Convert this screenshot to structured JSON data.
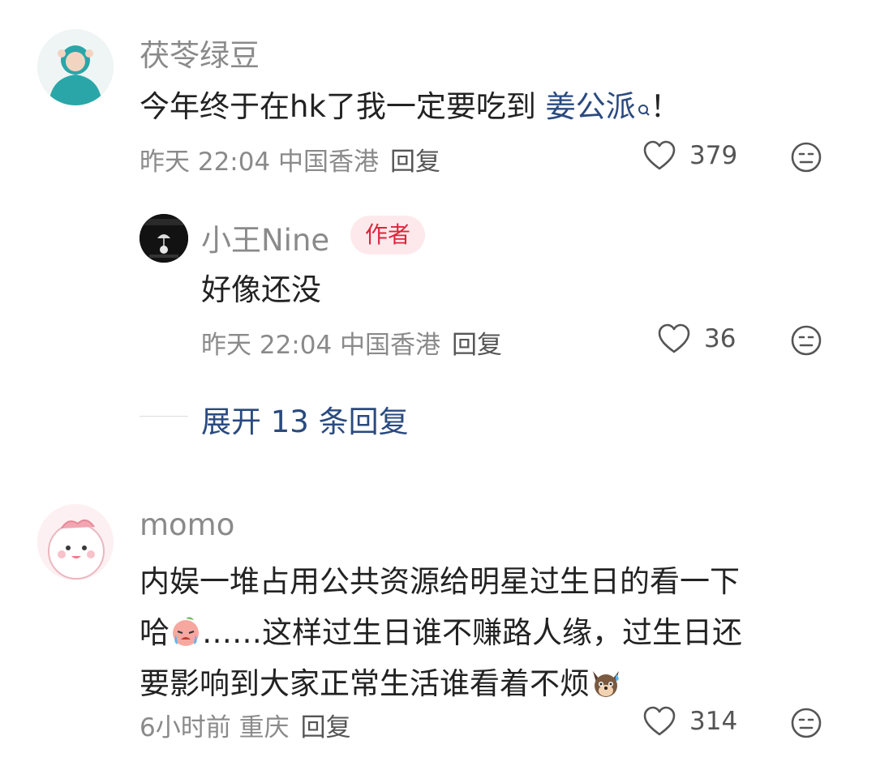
{
  "comments": [
    {
      "name": "茯苓绿豆",
      "text_before": "今年终于在hk了我一定要吃到 ",
      "link": "姜公派",
      "text_after": "！",
      "time": "昨天 22:04 中国香港",
      "reply_label": "回复",
      "likes": "379",
      "reply": {
        "name": "小王Nine",
        "badge": "作者",
        "text": "好像还没",
        "time": "昨天 22:04 中国香港",
        "reply_label": "回复",
        "likes": "36"
      },
      "expand_label": "展开 13 条回复"
    },
    {
      "name": "momo",
      "lines": [
        "内娱一堆占用公共资源给明星过生日的看一下",
        "哈",
        "……这样过生日谁不赚路人缘，过生日还",
        "要影响到大家正常生活谁看着不烦"
      ],
      "time": "6小时前 重庆",
      "reply_label": "回复",
      "likes": "314"
    }
  ],
  "icons": {
    "like": "heart-outline-icon",
    "dislike": "neutral-face-icon",
    "search": "search-icon",
    "crying-emoji": "crying-peach-emoji",
    "dog-emoji": "sweating-dog-emoji"
  },
  "colors": {
    "link": "#2a4a7f",
    "badge_bg": "#fde9ec",
    "badge_text": "#e0243c",
    "meta": "#8a8a8a"
  }
}
